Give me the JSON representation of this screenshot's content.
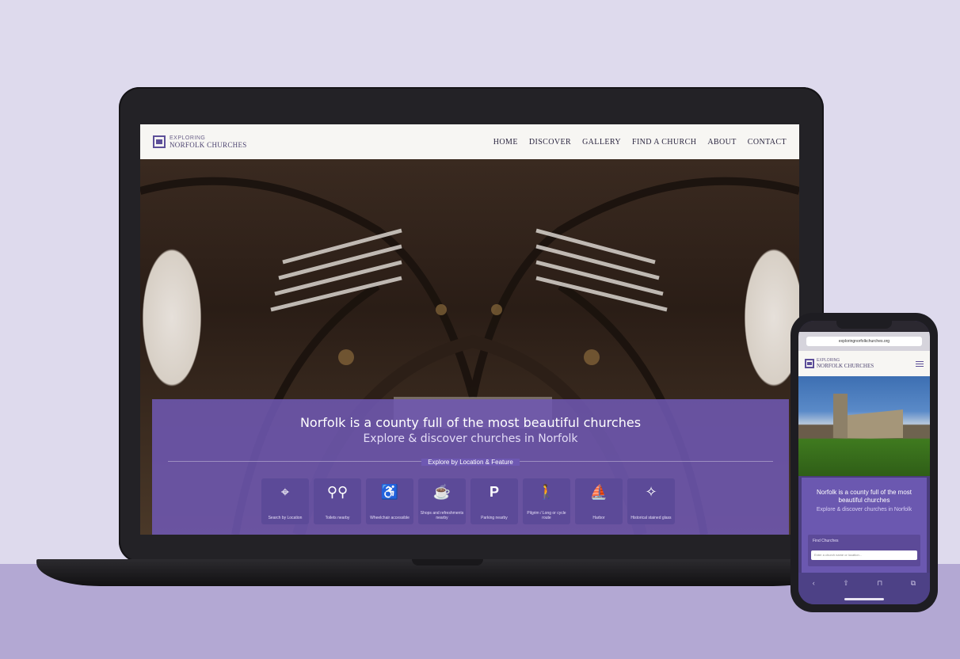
{
  "laptop_site": {
    "logo": {
      "small": "EXPLORING",
      "big": "NORFOLK CHURCHES"
    },
    "nav": [
      "HOME",
      "DISCOVER",
      "GALLERY",
      "FIND A CHURCH",
      "ABOUT",
      "CONTACT"
    ],
    "hero": {
      "title": "Norfolk is a county full of the most beautiful churches",
      "subtitle": "Explore & discover churches in Norfolk",
      "explore_label": "Explore by Location & Feature"
    },
    "tiles": [
      {
        "icon": "map-pin-icon",
        "glyph": "⌖",
        "label": "Search by Location"
      },
      {
        "icon": "toilets-icon",
        "glyph": "⚲⚲",
        "label": "Toilets nearby"
      },
      {
        "icon": "wheelchair-icon",
        "glyph": "♿",
        "label": "Wheelchair accessible"
      },
      {
        "icon": "refreshments-icon",
        "glyph": "☕",
        "label": "Shops and refreshments nearby"
      },
      {
        "icon": "parking-icon",
        "glyph": "P",
        "label": "Parking nearby"
      },
      {
        "icon": "walking-icon",
        "glyph": "🚶",
        "label": "Pilgrim / Long or cycle route"
      },
      {
        "icon": "sailing-icon",
        "glyph": "⛵",
        "label": "Harbor"
      },
      {
        "icon": "stained-glass-icon",
        "glyph": "✧",
        "label": "Historical stained glass"
      }
    ]
  },
  "phone_site": {
    "url": "exploringnorfolkchurches.org",
    "logo": {
      "small": "EXPLORING",
      "big": "NORFOLK CHURCHES"
    },
    "hero": {
      "title": "Norfolk is a county full of the most beautiful churches",
      "subtitle": "Explore & discover churches in Norfolk"
    },
    "search": {
      "label": "Find Churches",
      "placeholder": "Enter a church name or location..."
    }
  },
  "colors": {
    "page_bg_top": "#dedaed",
    "page_bg_bottom": "#b3a8d3",
    "brand_purple": "#6e58b2",
    "tile_purple": "#5c4a98"
  }
}
